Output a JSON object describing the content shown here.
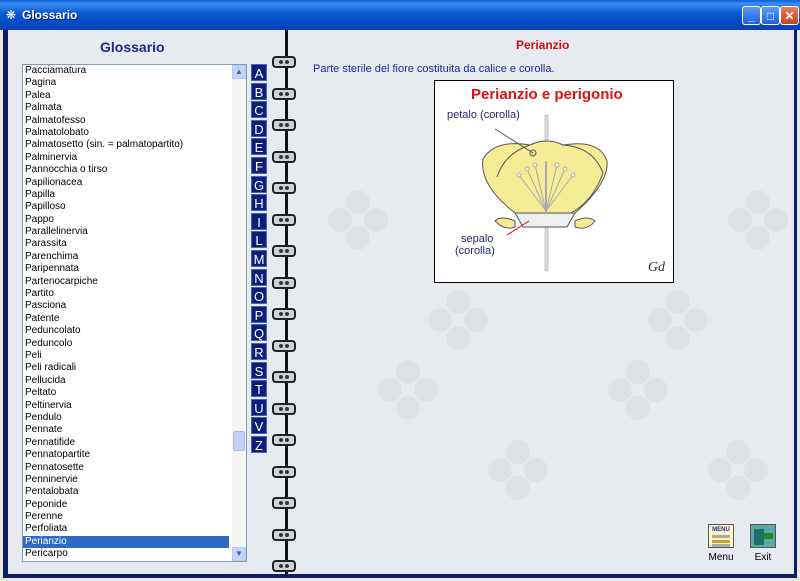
{
  "window": {
    "title": "Glossario"
  },
  "left": {
    "heading": "Glossario",
    "items": [
      "Pacciamatura",
      "Pagina",
      "Palea",
      "Palmata",
      "Palmatofesso",
      "Palmatolobato",
      "Palmatosetto (sin. = palmatopartito)",
      "Palminervia",
      "Pannocchia o tirso",
      "Papilionacea",
      "Papilla",
      "Papilloso",
      "Pappo",
      "Parallelinervia",
      "Parassita",
      "Parenchima",
      "Paripennata",
      "Partenocarpiche",
      "Partito",
      "Pasciona",
      "Patente",
      "Peduncolato",
      "Peduncolo",
      "Peli",
      "Peli radicali",
      "Pellucida",
      "Peltato",
      "Peltinervia",
      "Pendulo",
      "Pennate",
      "Pennatifide",
      "Pennatopartite",
      "Pennatosette",
      "Penninervie",
      "Pentalobata",
      "Peponide",
      "Perenne",
      "Perfoliata",
      "Perianzio",
      "Pericarpo"
    ],
    "selected_item": "Perianzio"
  },
  "alphabet": [
    "A",
    "B",
    "C",
    "D",
    "E",
    "F",
    "G",
    "H",
    "I",
    "L",
    "M",
    "N",
    "O",
    "P",
    "Q",
    "R",
    "S",
    "T",
    "U",
    "V",
    "Z"
  ],
  "right": {
    "term": "Perianzio",
    "definition": "Parte sterile del fiore costituita da calice e corolla.",
    "image": {
      "title": "Perianzio e perigonio",
      "label_petal": "petalo (corolla)",
      "label_sepal_1": "sepalo",
      "label_sepal_2": "(corolla)",
      "signature": "Gd"
    }
  },
  "buttons": {
    "menu": "Menu",
    "menu_icon_text": "MENU",
    "exit": "Exit"
  }
}
